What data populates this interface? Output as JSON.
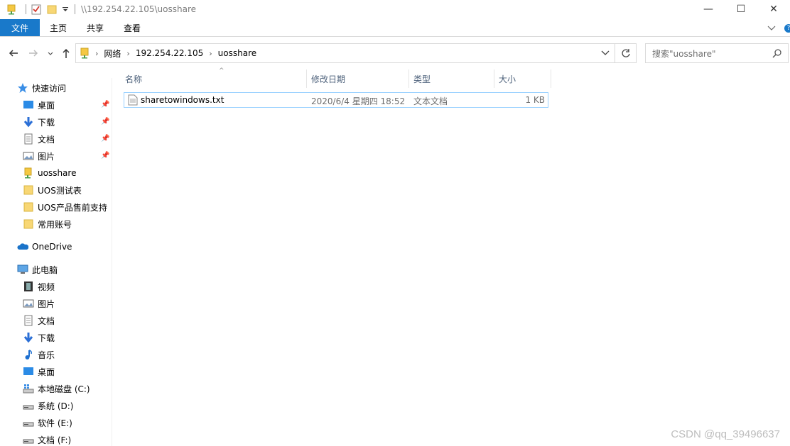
{
  "window": {
    "title": "\\\\192.254.22.105\\uosshare",
    "minimize_glyph": "—",
    "maximize_glyph": "☐",
    "close_glyph": "✕"
  },
  "ribbon": {
    "tabs": [
      "文件",
      "主页",
      "共享",
      "查看"
    ],
    "help": "?"
  },
  "address": {
    "crumbs": [
      "网络",
      "192.254.22.105",
      "uosshare"
    ],
    "search_placeholder": "搜索\"uosshare\""
  },
  "sidebar": {
    "quick_access": "快速访问",
    "quick_items": [
      "桌面",
      "下载",
      "文档",
      "图片",
      "uosshare",
      "UOS测试表",
      "UOS产品售前支持",
      "常用账号"
    ],
    "onedrive": "OneDrive",
    "this_pc": "此电脑",
    "pc_items": [
      "视频",
      "图片",
      "文档",
      "下载",
      "音乐",
      "桌面",
      "本地磁盘 (C:)",
      "系统 (D:)",
      "软件 (E:)",
      "文档 (F:)"
    ]
  },
  "columns": {
    "name": "名称",
    "date": "修改日期",
    "type": "类型",
    "size": "大小"
  },
  "files": [
    {
      "name": "sharetowindows.txt",
      "date": "2020/6/4 星期四 18:52",
      "type": "文本文档",
      "size": "1 KB"
    }
  ],
  "watermark": "CSDN @qq_39496637",
  "colors": {
    "accent": "#1979ca",
    "selection_border": "#99d1ff",
    "header_text": "#4c607a"
  }
}
